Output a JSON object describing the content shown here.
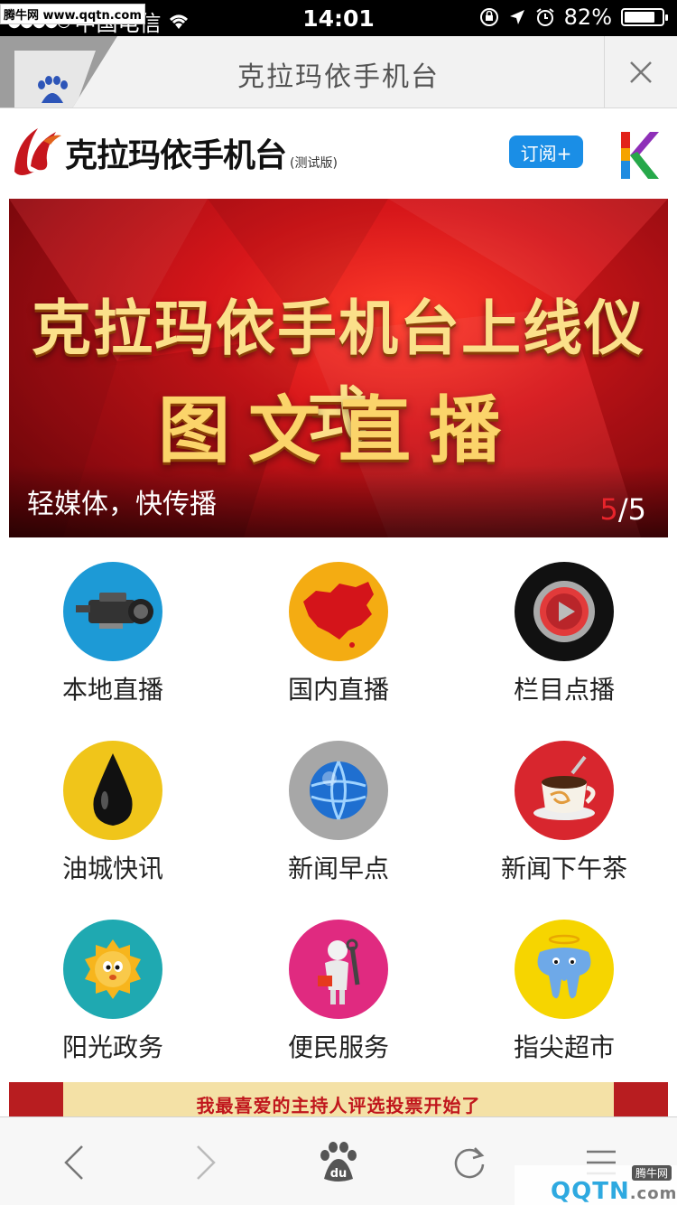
{
  "status_bar": {
    "carrier": "中国电信",
    "time": "14:01",
    "battery_percent": "82%",
    "battery_level": 0.82,
    "watermark": "腾牛网 www.qqtn.com"
  },
  "browser": {
    "page_title": "克拉玛依手机台"
  },
  "site": {
    "logo_name": "克拉玛依手机台",
    "logo_sub": "(测试版)",
    "subscribe_label": "订阅+"
  },
  "banner": {
    "headline_1": "克拉玛依手机台上线仪式",
    "headline_2": "图文直播",
    "caption": "轻媒体，快传播",
    "pager_current": "5",
    "pager_total": "/5"
  },
  "grid": [
    {
      "label": "本地直播",
      "icon": "video-camera-icon",
      "bg": "#1d9ad6"
    },
    {
      "label": "国内直播",
      "icon": "china-map-icon",
      "bg": "#f4ac12"
    },
    {
      "label": "栏目点播",
      "icon": "play-button-icon",
      "bg": "#111111"
    },
    {
      "label": "油城快讯",
      "icon": "oil-drop-icon",
      "bg": "#f0c51a"
    },
    {
      "label": "新闻早点",
      "icon": "globe-icon",
      "bg": "#a7a7a7"
    },
    {
      "label": "新闻下午茶",
      "icon": "coffee-cup-icon",
      "bg": "#d8262e"
    },
    {
      "label": "阳光政务",
      "icon": "sun-face-icon",
      "bg": "#1fa9b1"
    },
    {
      "label": "便民服务",
      "icon": "repairman-icon",
      "bg": "#e02a80"
    },
    {
      "label": "指尖超市",
      "icon": "elephant-icon",
      "bg": "#f6d500"
    }
  ],
  "promo": {
    "text": "我最喜爱的主持人评选投票开始了"
  },
  "toolbar": {
    "items": [
      "back-icon",
      "forward-icon",
      "baidu-paw-icon",
      "refresh-icon",
      "menu-icon"
    ],
    "baidu_text": "du"
  },
  "watermark_bottom": {
    "brand": "腾牛网",
    "logo": "QQTN",
    "domain": ".com"
  }
}
